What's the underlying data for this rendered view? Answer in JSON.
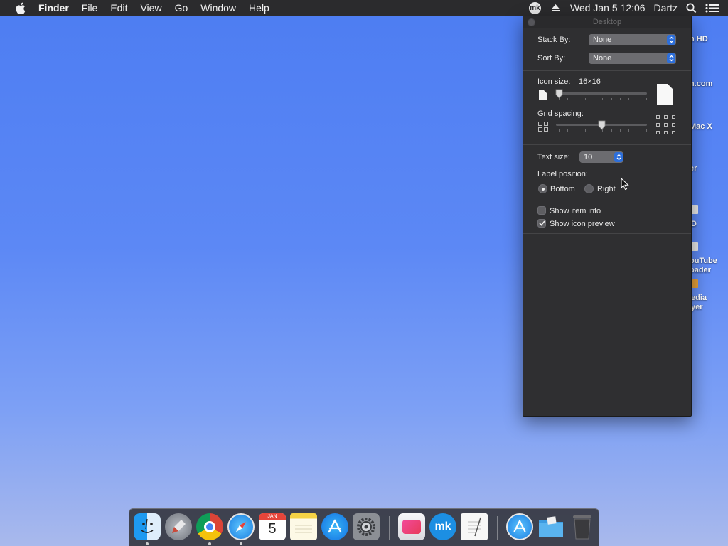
{
  "menubar": {
    "app_name": "Finder",
    "menus": [
      "File",
      "Edit",
      "View",
      "Go",
      "Window",
      "Help"
    ],
    "status": {
      "mk_label": "mk",
      "datetime": "Wed Jan 5  12:06",
      "user": "Dartz"
    }
  },
  "desktop_labels": [
    "h HD",
    "n.com",
    "Mac X",
    "er",
    "D",
    "ouTube",
    "oader",
    "edia",
    "yer"
  ],
  "panel": {
    "title": "Desktop",
    "stack_by": {
      "label": "Stack By:",
      "value": "None"
    },
    "sort_by": {
      "label": "Sort By:",
      "value": "None"
    },
    "icon_size": {
      "label": "Icon size:",
      "value": "16×16",
      "level": 0.0
    },
    "grid_spacing": {
      "label": "Grid spacing:",
      "level": 0.5
    },
    "text_size": {
      "label": "Text size:",
      "value": "10"
    },
    "label_position": {
      "label": "Label position:",
      "options": [
        "Bottom",
        "Right"
      ],
      "selected": "Bottom"
    },
    "show_item_info": {
      "label": "Show item info",
      "checked": false
    },
    "show_icon_preview": {
      "label": "Show icon preview",
      "checked": true
    }
  },
  "dock": {
    "calendar_month": "JAN",
    "calendar_day": "5",
    "items": [
      "finder-icon",
      "launchpad-icon",
      "chrome-icon",
      "safari-icon",
      "calendar-icon",
      "notes-icon",
      "app-store-icon",
      "system-preferences-icon",
      "cleanmymac-icon",
      "mk-app-icon",
      "textedit-icon",
      "app-store-downloads-icon",
      "folder-icon",
      "trash-icon"
    ]
  },
  "colors": {
    "desktop_top": "#4d7df2",
    "desktop_bottom": "#a9b9ec",
    "menubar_bg": "#2b2b2d",
    "panel_bg": "#2f2f31",
    "accent_blue": "#2d6fdb"
  }
}
